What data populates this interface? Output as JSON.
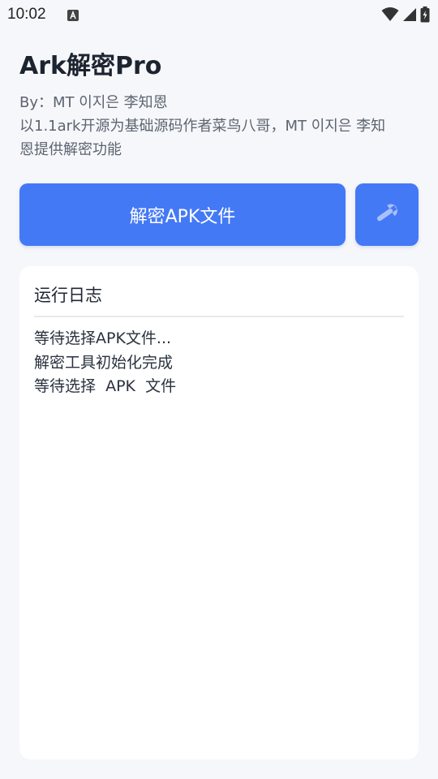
{
  "status_bar": {
    "time": "10:02",
    "notification_icon": "font-a-icon",
    "icons": [
      "wifi-icon",
      "signal-icon",
      "battery-charging-icon"
    ]
  },
  "app": {
    "title": "Ark解密Pro",
    "subtitle_lines": [
      "By：MT 이지은 李知恩",
      "以1.1ark开源为基础源码作者菜鸟八哥，MT 이지은 李知",
      "恩提供解密功能"
    ]
  },
  "actions": {
    "decrypt_label": "解密APK文件",
    "tools_icon": "wrench-icon"
  },
  "log": {
    "title": "运行日志",
    "lines": [
      "等待选择APK文件...",
      "解密工具初始化完成",
      "等待选择  APK  文件"
    ]
  },
  "colors": {
    "accent": "#4479f6",
    "background": "#f6f7fa",
    "card": "#ffffff"
  }
}
